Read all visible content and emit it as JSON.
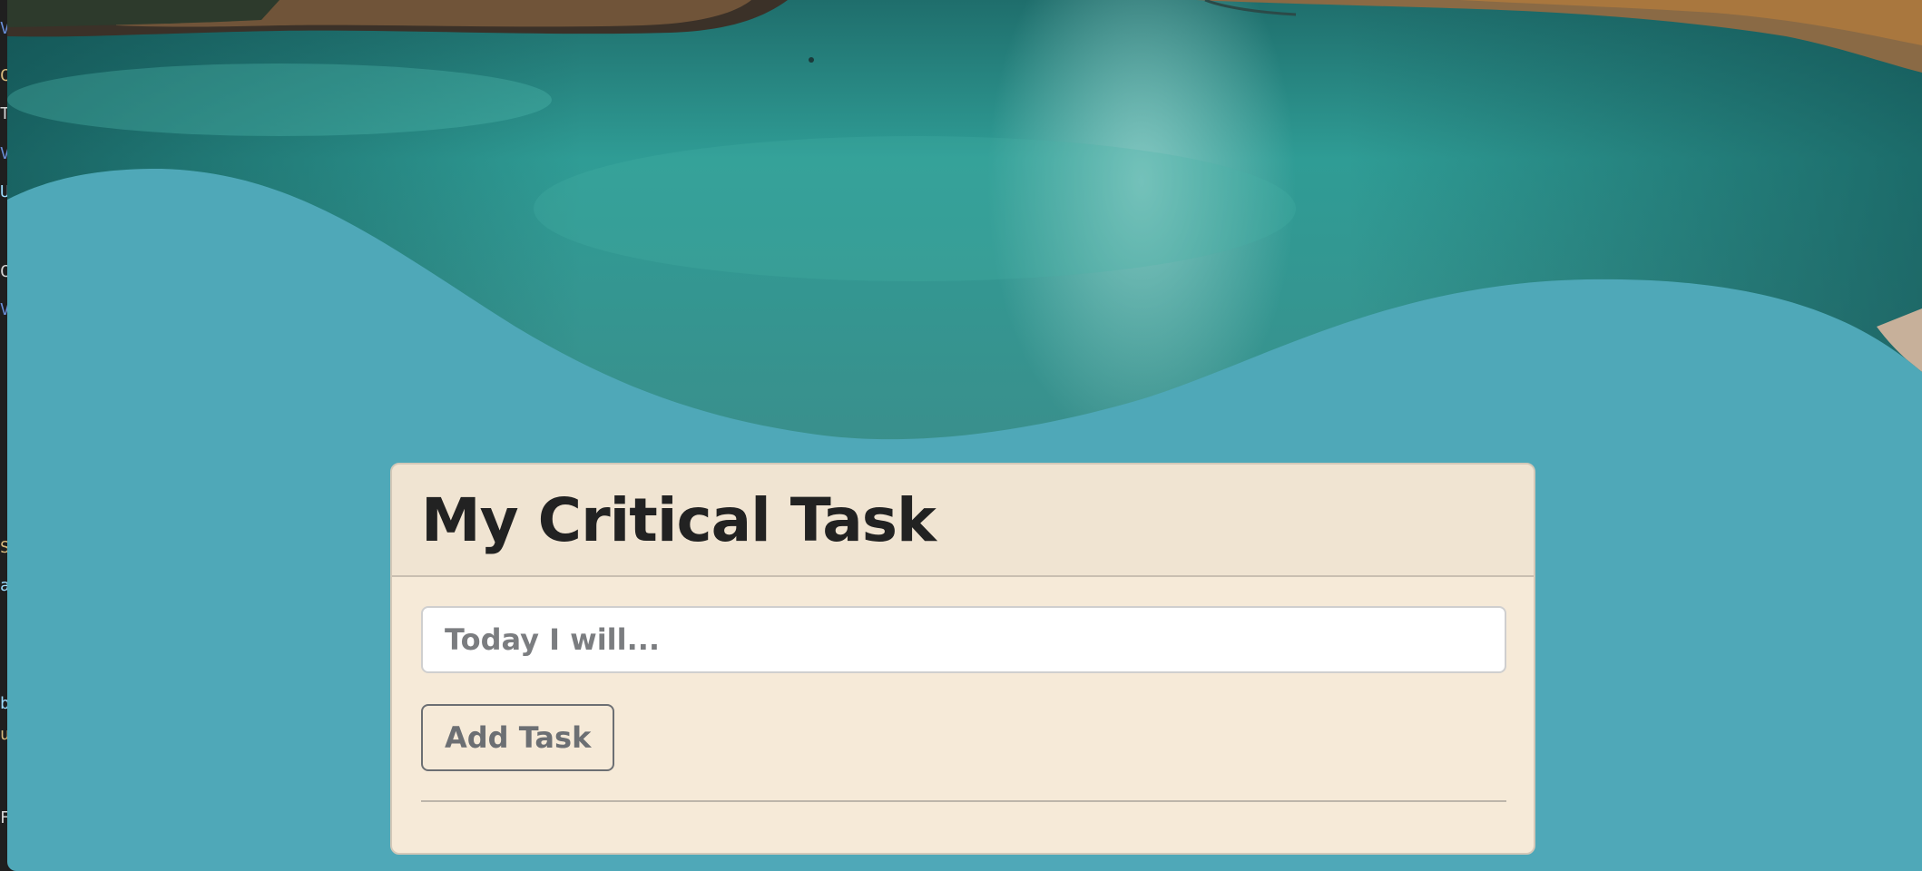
{
  "app": {
    "title": "My Critical Task"
  },
  "task_input": {
    "placeholder": "Today I will...",
    "value": ""
  },
  "add_button": {
    "label": "Add Task"
  },
  "gutter_glyphs": [
    "V",
    "C",
    "T",
    "V",
    "U",
    "C",
    "V",
    "S",
    "a",
    "b",
    "u",
    "F"
  ],
  "colors": {
    "page_background": "#4fa8b8",
    "card_background": "#f6ead8",
    "card_header_background": "#f0e4d2",
    "title_text": "#222222",
    "water_teal": "#2f9c95",
    "button_border": "#6c6f73"
  }
}
